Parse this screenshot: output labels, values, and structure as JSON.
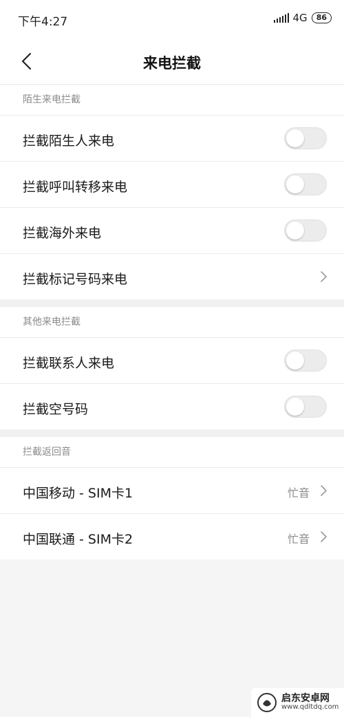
{
  "status": {
    "time": "下午4:27",
    "network": "4G",
    "battery": "86"
  },
  "nav": {
    "title": "来电拦截"
  },
  "sections": [
    {
      "header": "陌生来电拦截",
      "rows": [
        {
          "label": "拦截陌生人来电",
          "type": "toggle",
          "on": false
        },
        {
          "label": "拦截呼叫转移来电",
          "type": "toggle",
          "on": false
        },
        {
          "label": "拦截海外来电",
          "type": "toggle",
          "on": false
        },
        {
          "label": "拦截标记号码来电",
          "type": "link"
        }
      ]
    },
    {
      "header": "其他来电拦截",
      "rows": [
        {
          "label": "拦截联系人来电",
          "type": "toggle",
          "on": false
        },
        {
          "label": "拦截空号码",
          "type": "toggle",
          "on": false
        }
      ]
    },
    {
      "header": "拦截返回音",
      "rows": [
        {
          "label": "中国移动 - SIM卡1",
          "type": "link",
          "value": "忙音"
        },
        {
          "label": "中国联通 - SIM卡2",
          "type": "link",
          "value": "忙音"
        }
      ]
    }
  ],
  "watermark": {
    "name": "启东安卓网",
    "url": "www.qdltdq.com"
  },
  "colors": {
    "toggle_off_track": "#ececec",
    "section_header": "#8a8a8a",
    "background": "#f5f5f5"
  }
}
